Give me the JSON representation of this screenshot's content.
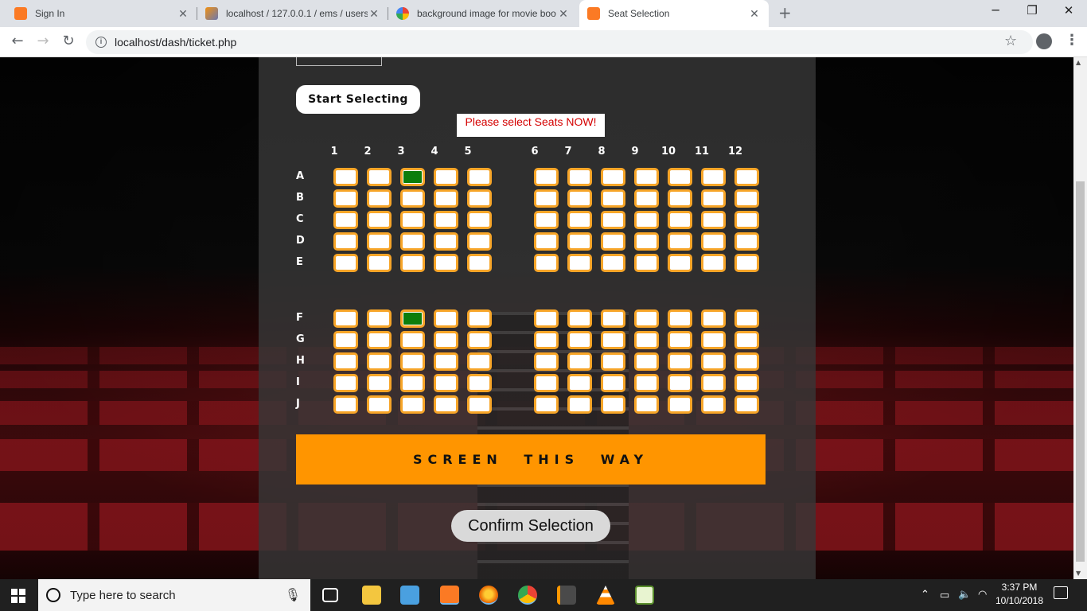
{
  "browser": {
    "tabs": [
      {
        "title": "Sign In",
        "favicon": "xampp-icon",
        "active": false
      },
      {
        "title": "localhost / 127.0.0.1 / ems / users",
        "favicon": "phpmyadmin-icon",
        "active": false
      },
      {
        "title": "background image for movie boo",
        "favicon": "google-icon",
        "active": false
      },
      {
        "title": "Seat Selection",
        "favicon": "xampp-icon",
        "active": true
      }
    ],
    "new_tab": "+",
    "url": "localhost/dash/ticket.php",
    "window_controls": {
      "minimize": "─",
      "restore": "❐",
      "close": "✕"
    }
  },
  "page": {
    "start_button": "Start Selecting",
    "notice": "Please select Seats NOW!",
    "columns": [
      "1",
      "2",
      "3",
      "4",
      "5",
      "6",
      "7",
      "8",
      "9",
      "10",
      "11",
      "12"
    ],
    "rows_top": [
      "A",
      "B",
      "C",
      "D",
      "E"
    ],
    "rows_bottom": [
      "F",
      "G",
      "H",
      "I",
      "J"
    ],
    "selected_seats": [
      "A3",
      "F3"
    ],
    "screen_banner": "SCREEN THIS WAY",
    "confirm_button": "Confirm Selection"
  },
  "taskbar": {
    "search_placeholder": "Type here to search",
    "time": "3:37 PM",
    "date": "10/10/2018",
    "apps": [
      "task-view-icon",
      "file-explorer-icon",
      "media-player-icon",
      "xampp-icon",
      "firefox-icon",
      "chrome-icon",
      "sublime-text-icon",
      "vlc-icon",
      "notepad-icon"
    ]
  },
  "colors": {
    "seat_border": "#f7a528",
    "seat_selected": "#0b7d0b",
    "banner": "#ff9500",
    "notice_text": "#d40000"
  }
}
